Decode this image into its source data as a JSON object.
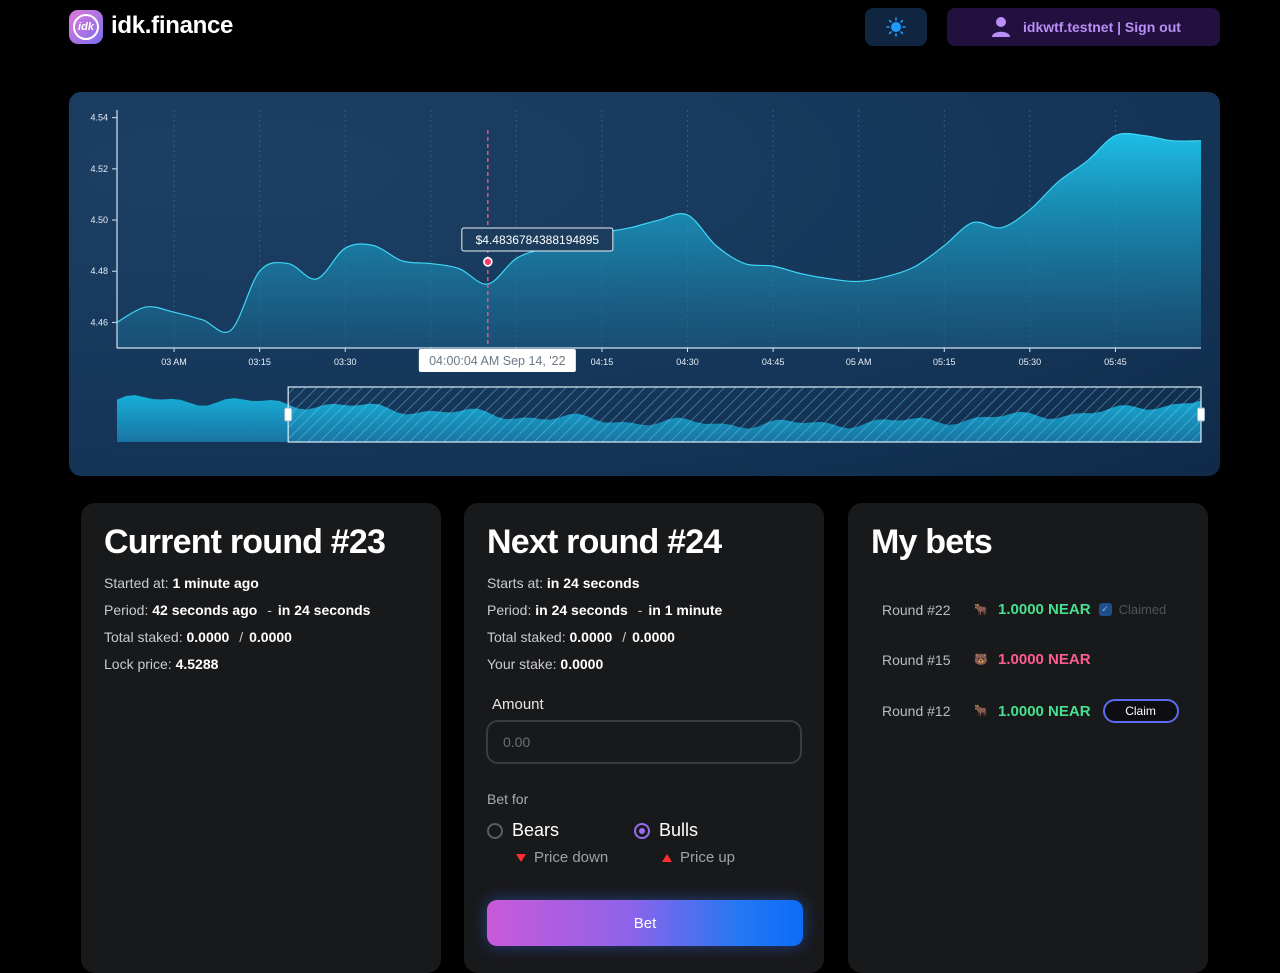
{
  "header": {
    "logo_text": "idk",
    "brand": "idk.finance",
    "user_label": "idkwtf.testnet | Sign out"
  },
  "icons": {
    "theme": "sun-icon",
    "user": "user-icon"
  },
  "colors": {
    "accent_purple": "#9b6cf2",
    "bull_green": "#46e08f",
    "bear_pink": "#ff5d8f",
    "chart_fill": "#1ec5ee"
  },
  "chart_data": {
    "type": "area",
    "x": [
      "02:50",
      "02:55",
      "03:00",
      "03:05",
      "03:10",
      "03:15",
      "03:20",
      "03:25",
      "03:30",
      "03:35",
      "03:40",
      "03:45",
      "03:50",
      "03:55",
      "04:00",
      "04:05",
      "04:10",
      "04:15",
      "04:20",
      "04:25",
      "04:30",
      "04:35",
      "04:40",
      "04:45",
      "04:50",
      "04:55",
      "05:00",
      "05:05",
      "05:10",
      "05:15",
      "05:20",
      "05:25",
      "05:30",
      "05:35",
      "05:40",
      "05:45",
      "05:50",
      "05:55",
      "06:00"
    ],
    "y": [
      4.46,
      4.466,
      4.464,
      4.461,
      4.457,
      4.48,
      4.483,
      4.477,
      4.489,
      4.49,
      4.484,
      4.483,
      4.481,
      4.475,
      4.485,
      4.489,
      4.492,
      4.495,
      4.497,
      4.5,
      4.502,
      4.49,
      4.483,
      4.482,
      4.479,
      4.477,
      4.476,
      4.478,
      4.482,
      4.49,
      4.499,
      4.497,
      4.504,
      4.515,
      4.523,
      4.533,
      4.533,
      4.531,
      4.531
    ],
    "x_ticks": [
      "03 AM",
      "03:15",
      "03:30",
      "03:45",
      "04:00",
      "04:15",
      "04:30",
      "04:45",
      "05 AM",
      "05:15",
      "05:30",
      "05:45"
    ],
    "y_ticks": [
      "4.46",
      "4.48",
      "4.50",
      "4.52",
      "4.54"
    ],
    "ylim": [
      4.45,
      4.543
    ],
    "tooltip_value": "$4.4836784388194895",
    "crosshair_time": "04:00:04 AM Sep 14, '22",
    "crosshair_x": "03:55",
    "crosshair_y": 4.4836784388194895,
    "grid": true,
    "navigator": true,
    "navigator_window": [
      "03:20",
      "06:00"
    ]
  },
  "current_round": {
    "title": "Current round #23",
    "started_label": "Started at:",
    "started_value": "1 minute ago",
    "period_label": "Period:",
    "period_from": "42 seconds ago",
    "period_sep": "-",
    "period_to": "in 24 seconds",
    "staked_label": "Total staked:",
    "staked_a": "0.0000",
    "staked_sep": "/",
    "staked_b": "0.0000",
    "lock_label": "Lock price:",
    "lock_value": "4.5288"
  },
  "next_round": {
    "title": "Next round #24",
    "starts_label": "Starts at:",
    "starts_value": "in 24 seconds",
    "period_label": "Period:",
    "period_from": "in 24 seconds",
    "period_sep": "-",
    "period_to": "in 1 minute",
    "staked_label": "Total staked:",
    "staked_a": "0.0000",
    "staked_sep": "/",
    "staked_b": "0.0000",
    "your_stake_label": "Your stake:",
    "your_stake_value": "0.0000",
    "amount_label": "Amount",
    "amount_placeholder": "0.00",
    "bet_for_label": "Bet for",
    "bears_label": "Bears",
    "bears_hint": "Price down",
    "bulls_label": "Bulls",
    "bulls_hint": "Price up",
    "selected": "Bulls",
    "bet_button": "Bet"
  },
  "my_bets": {
    "title": "My bets",
    "items": [
      {
        "round": "Round #22",
        "icon": "bull-icon",
        "amount": "1.0000 NEAR",
        "status": "Claimed"
      },
      {
        "round": "Round #15",
        "icon": "bear-icon",
        "amount": "1.0000 NEAR",
        "status": ""
      },
      {
        "round": "Round #12",
        "icon": "bull-icon",
        "amount": "1.0000 NEAR",
        "status": "Claim"
      }
    ]
  }
}
